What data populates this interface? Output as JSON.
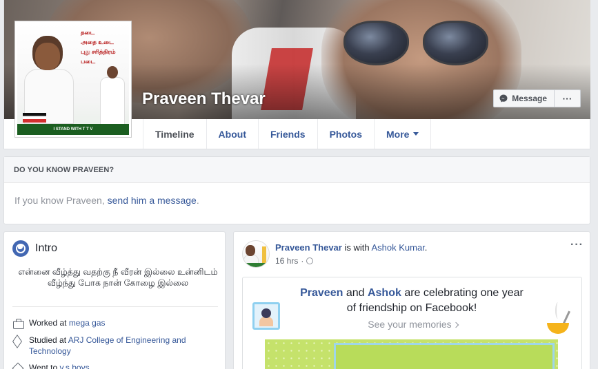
{
  "profile": {
    "name": "Praveen Thevar",
    "picture": {
      "text_lines": [
        "தடை",
        "அதை உடை",
        "புது சரித்திரம்",
        "படை"
      ],
      "banner": "I STAND WITH T T V"
    }
  },
  "cover_actions": {
    "message_label": "Message",
    "more_label": "···"
  },
  "nav": {
    "items": [
      {
        "label": "Timeline"
      },
      {
        "label": "About"
      },
      {
        "label": "Friends"
      },
      {
        "label": "Photos"
      },
      {
        "label": "More"
      }
    ]
  },
  "know": {
    "heading": "DO YOU KNOW PRAVEEN?",
    "prefix": "If you know Praveen, ",
    "link": "send him a message",
    "suffix": "."
  },
  "intro": {
    "title": "Intro",
    "bio": "என்னை வீழ்த்து வதற்கு நீ வீரன் இல்லை உன்னிடம் வீழ்ந்து போக நான் கோழை இல்லை",
    "items": [
      {
        "prefix": "Worked at ",
        "link": "mega gas",
        "icon": "briefcase-icon"
      },
      {
        "prefix": "Studied at ",
        "link": "ARJ College of Engineering and Technology",
        "icon": "graduation-cap-icon"
      },
      {
        "prefix": "Went to ",
        "link": "v.s.boys",
        "icon": "school-icon"
      }
    ]
  },
  "post": {
    "author": "Praveen Thevar",
    "with_text": " is with ",
    "with_name": "Ashok Kumar",
    "with_suffix": ".",
    "time": "16 hrs",
    "separator": "·",
    "dots": "···",
    "memory": {
      "name1": "Praveen",
      "and": " and ",
      "name2": "Ashok",
      "text": " are celebrating one year of friendship on Facebook!",
      "link": "See your memories"
    }
  },
  "colors": {
    "link": "#365899",
    "accent": "#4267b2",
    "background": "#e9ebee"
  }
}
